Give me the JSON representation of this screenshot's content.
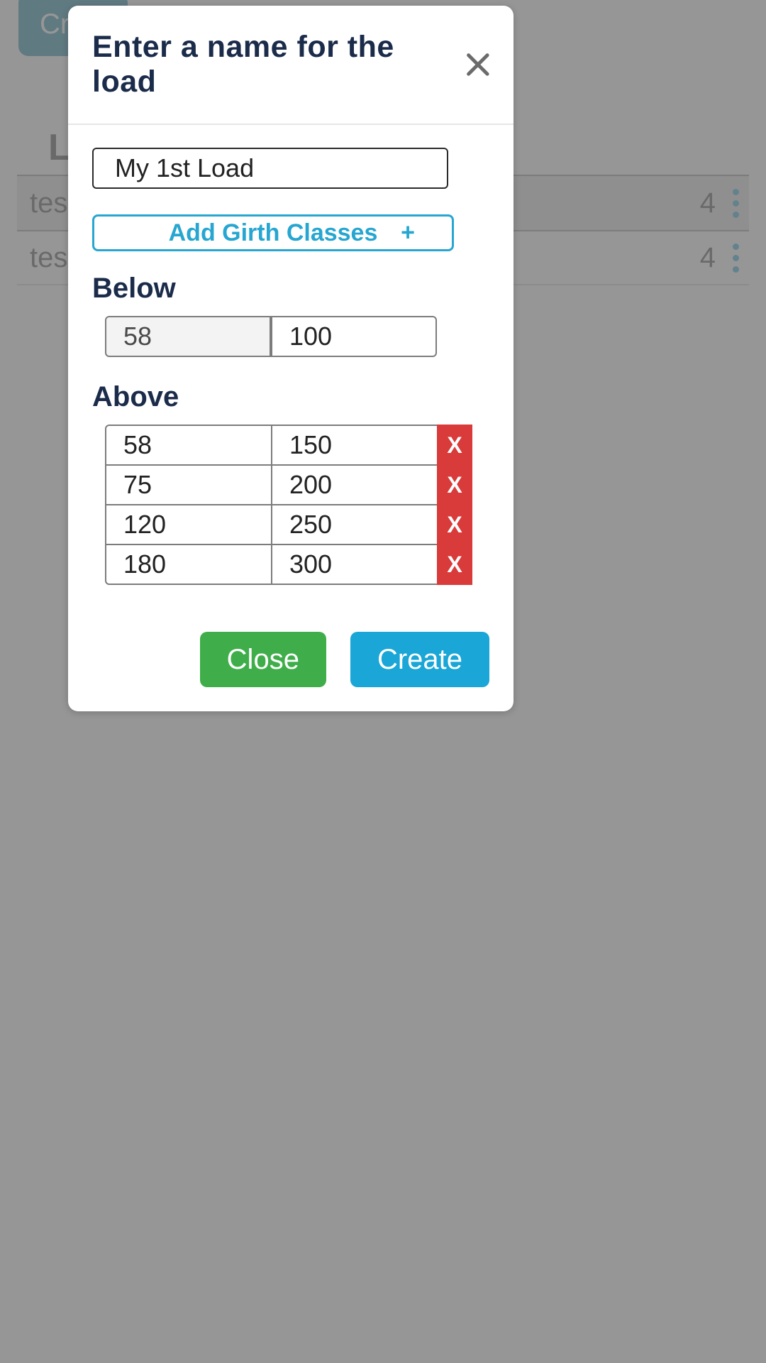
{
  "background": {
    "create_button": "Cre",
    "section_title": "Lo",
    "rows": [
      {
        "name": "test",
        "value": "4"
      },
      {
        "name": "test",
        "value": "4"
      }
    ]
  },
  "modal": {
    "title": "Enter a name for the load",
    "name_value": "My 1st Load",
    "add_girth_label": "Add Girth Classes",
    "add_girth_plus": "+",
    "below_label": "Below",
    "below_row": {
      "threshold": "58",
      "value": "100"
    },
    "above_label": "Above",
    "above_rows": [
      {
        "threshold": "58",
        "value": "150"
      },
      {
        "threshold": "75",
        "value": "200"
      },
      {
        "threshold": "120",
        "value": "250"
      },
      {
        "threshold": "180",
        "value": "300"
      }
    ],
    "delete_label": "X",
    "close_label": "Close",
    "create_label": "Create"
  }
}
